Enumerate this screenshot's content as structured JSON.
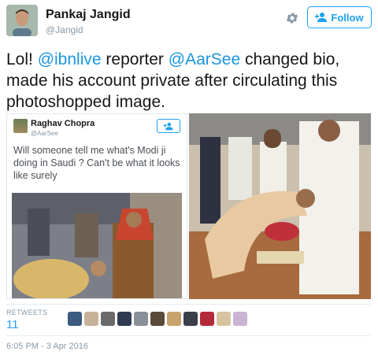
{
  "author": {
    "name": "Pankaj Jangid",
    "handle": "@Jangid"
  },
  "actions": {
    "follow_label": "Follow"
  },
  "tweet": {
    "text_1": "Lol! ",
    "mention_1": "@ibnlive",
    "text_2": " reporter ",
    "mention_2": "@AarSee",
    "text_3": " changed bio, made his account private after circulating this photoshopped image."
  },
  "embedded_tweet": {
    "name": "Raghav Chopra",
    "handle": "@AarSee",
    "text": "Will someone tell me what's Modi ji doing in Saudi ? Can't be what it looks like surely"
  },
  "stats": {
    "retweets_label": "RETWEETS",
    "retweets_count": "11",
    "avatar_colors": [
      "#3d5a80",
      "#c7b299",
      "#6b6b6b",
      "#2f3b52",
      "#8a8f98",
      "#5a4a3a",
      "#c8a26b",
      "#3a3f4a",
      "#b5283a",
      "#d8c3a0",
      "#c9b4d4"
    ]
  },
  "timestamp": "6:05 PM - 3 Apr 2016"
}
